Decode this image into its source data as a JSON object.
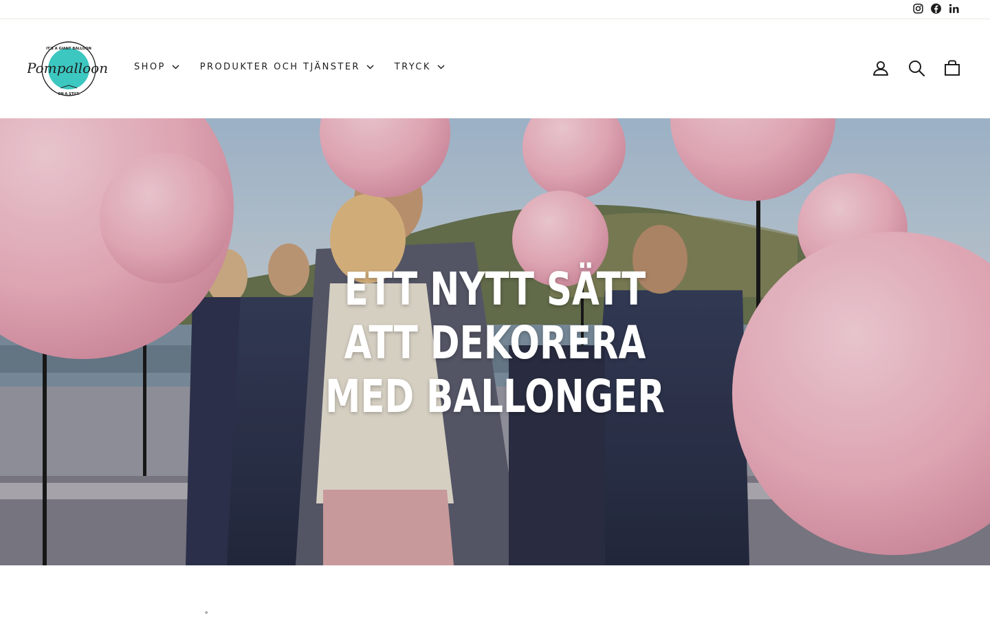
{
  "social": {
    "icons": [
      "instagram-icon",
      "facebook-icon",
      "linkedin-icon"
    ]
  },
  "brand": {
    "logo_name": "Pompalloon",
    "logo_tagline_top": "IT'S A GIANT BALLOON",
    "logo_tagline_bottom": "ON A STILT.",
    "accent": "#3cc7c0",
    "text_color": "#1c1d1d"
  },
  "nav": {
    "items": [
      {
        "label": "SHOP"
      },
      {
        "label": "PRODUKTER OCH TJÄNSTER"
      },
      {
        "label": "TRYCK"
      }
    ]
  },
  "utility": {
    "icons": [
      "account-icon",
      "search-icon",
      "cart-icon"
    ]
  },
  "hero": {
    "lines": [
      "ETT NYTT SÄTT",
      "ATT DEKORERA",
      "MED BALLONGER"
    ],
    "balloon_color": "#f2b6c4"
  },
  "below": {
    "mark": "°"
  }
}
